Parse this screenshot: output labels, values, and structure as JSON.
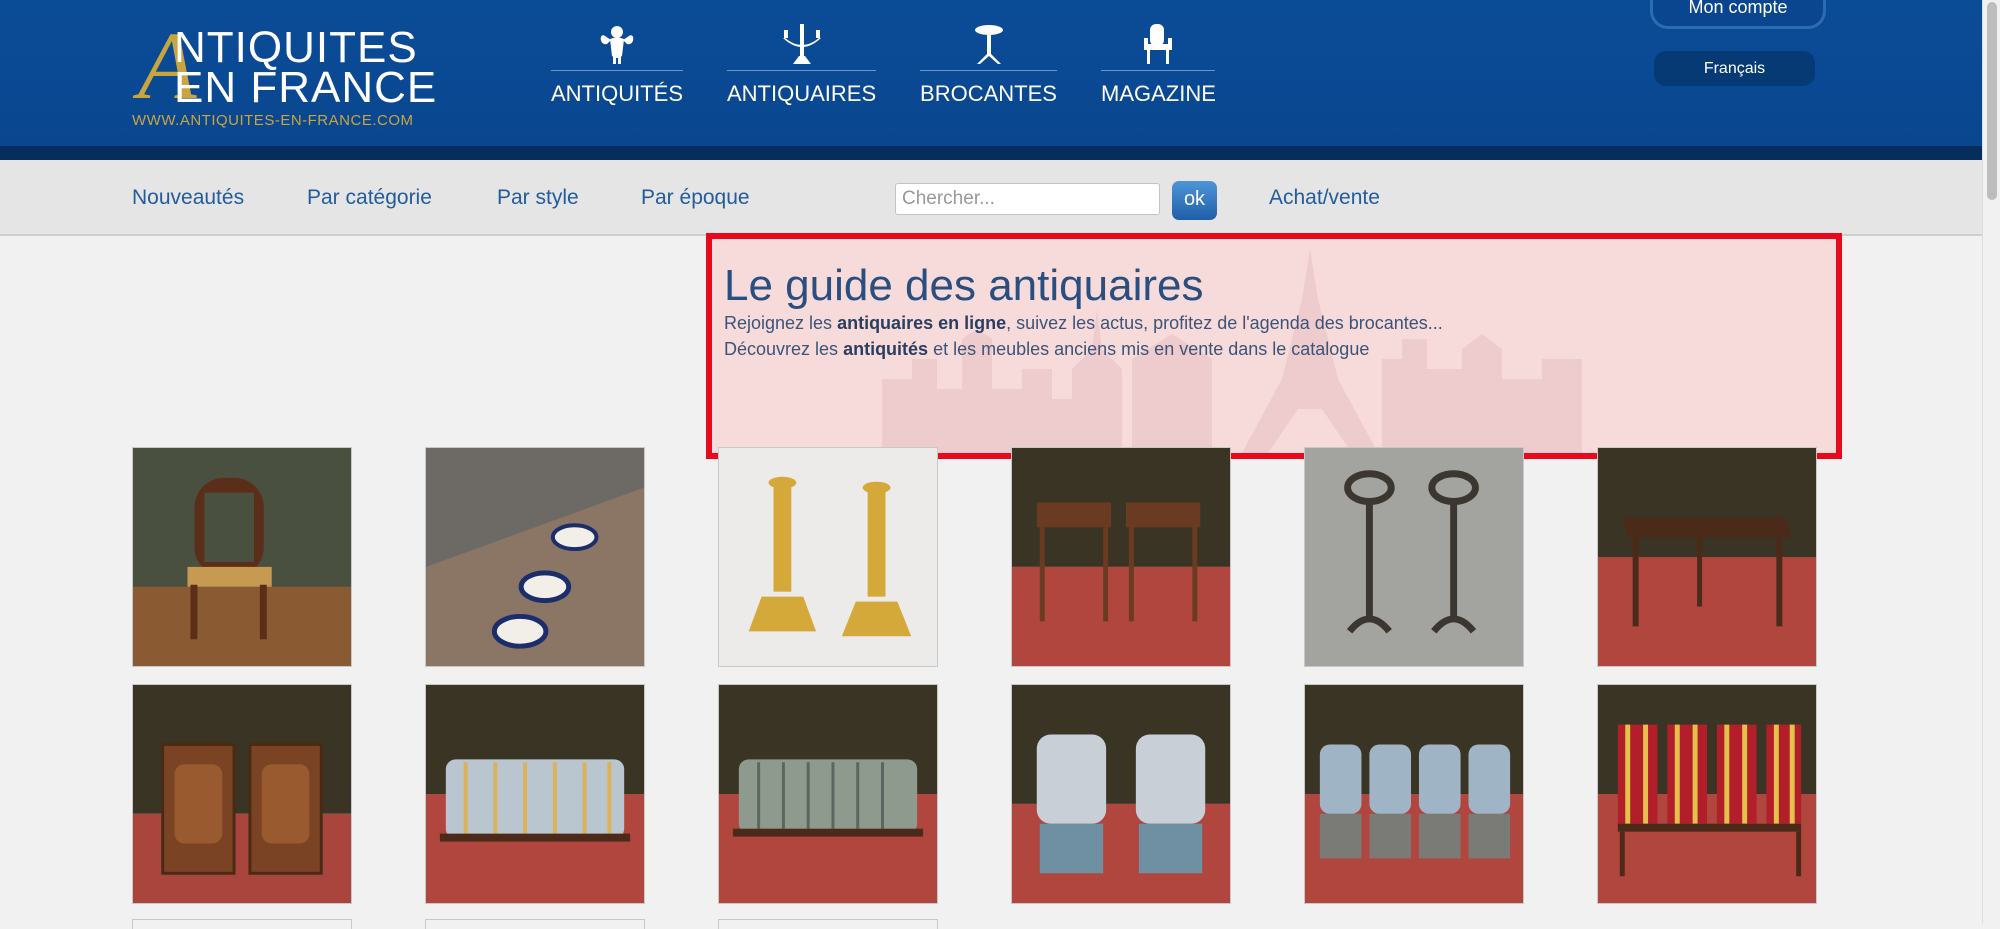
{
  "logo": {
    "initial": "A",
    "line1": "NTIQUITES",
    "line2": "EN FRANCE",
    "url": "WWW.ANTIQUITES-EN-FRANCE.COM"
  },
  "main_nav": [
    {
      "label": "ANTIQUITÉS",
      "icon": "cherub-icon"
    },
    {
      "label": "ANTIQUAIRES",
      "icon": "candelabra-icon"
    },
    {
      "label": "BROCANTES",
      "icon": "pedestal-table-icon"
    },
    {
      "label": "MAGAZINE",
      "icon": "armchair-icon"
    }
  ],
  "account": {
    "label": "Mon compte"
  },
  "language": {
    "label": "Français"
  },
  "sub_nav": {
    "links": [
      "Nouveautés",
      "Par catégorie",
      "Par style",
      "Par époque"
    ],
    "search_placeholder": "Chercher...",
    "search_button": "ok",
    "sell_link": "Achat/vente"
  },
  "hero": {
    "title": "Le guide des antiquaires",
    "line1_pre": "Rejoignez les ",
    "line1_bold": "antiquaires en ligne",
    "line1_post": ", suivez les actus, profitez de l'agenda des brocantes...",
    "line2_pre": "Découvrez les ",
    "line2_bold": "antiquités",
    "line2_post": " et les meubles anciens mis en vente dans le catalogue"
  },
  "products": [
    {
      "name": "Gothic cane chair"
    },
    {
      "name": "Porcelain dinner service"
    },
    {
      "name": "Pair of bronze candlesticks"
    },
    {
      "name": "Pair of side tables"
    },
    {
      "name": "Pair of andirons"
    },
    {
      "name": "Writing desk"
    },
    {
      "name": "Pair of bedside cabinets"
    },
    {
      "name": "Striped sofa"
    },
    {
      "name": "Striped settee"
    },
    {
      "name": "Pair of toile armchairs"
    },
    {
      "name": "Set of four armchairs"
    },
    {
      "name": "Set of striped chairs"
    }
  ],
  "colors": {
    "header_blue": "#0a4690",
    "gold": "#c9a53f",
    "link_blue": "#235c9c",
    "highlight_red": "#e8091d"
  }
}
